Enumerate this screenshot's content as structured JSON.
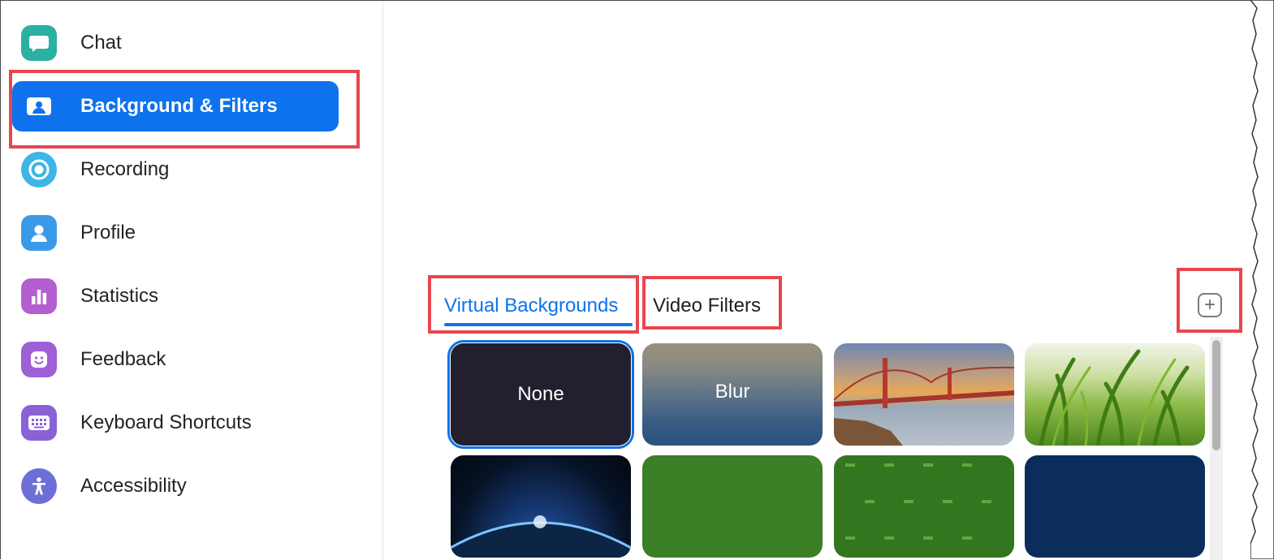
{
  "sidebar": {
    "items": [
      {
        "label": "Chat",
        "icon": "chat-icon",
        "color": "#2bb0a4"
      },
      {
        "label": "Background & Filters",
        "icon": "background-icon",
        "color": "#0e72ed",
        "active": true
      },
      {
        "label": "Recording",
        "icon": "recording-icon",
        "color": "#3db6e6"
      },
      {
        "label": "Profile",
        "icon": "profile-icon",
        "color": "#3b9ae8"
      },
      {
        "label": "Statistics",
        "icon": "statistics-icon",
        "color": "#b45ed0"
      },
      {
        "label": "Feedback",
        "icon": "feedback-icon",
        "color": "#9f5fd6"
      },
      {
        "label": "Keyboard Shortcuts",
        "icon": "keyboard-icon",
        "color": "#8b62d6"
      },
      {
        "label": "Accessibility",
        "icon": "accessibility-icon",
        "color": "#6e6fd6"
      }
    ]
  },
  "tabs": [
    {
      "label": "Virtual Backgrounds",
      "active": true
    },
    {
      "label": "Video Filters",
      "active": false
    }
  ],
  "add_button": {
    "icon": "plus-icon"
  },
  "backgrounds": [
    {
      "label": "None",
      "kind": "none",
      "selected": true
    },
    {
      "label": "Blur",
      "kind": "blur"
    },
    {
      "label": "",
      "kind": "golden-gate-bridge"
    },
    {
      "label": "",
      "kind": "grass"
    },
    {
      "label": "",
      "kind": "earth-from-space"
    },
    {
      "label": "",
      "kind": "green-branded"
    },
    {
      "label": "",
      "kind": "green-pattern"
    },
    {
      "label": "",
      "kind": "navy-branded"
    }
  ],
  "colors": {
    "accent": "#0e72ed",
    "highlight": "#e8464f"
  }
}
